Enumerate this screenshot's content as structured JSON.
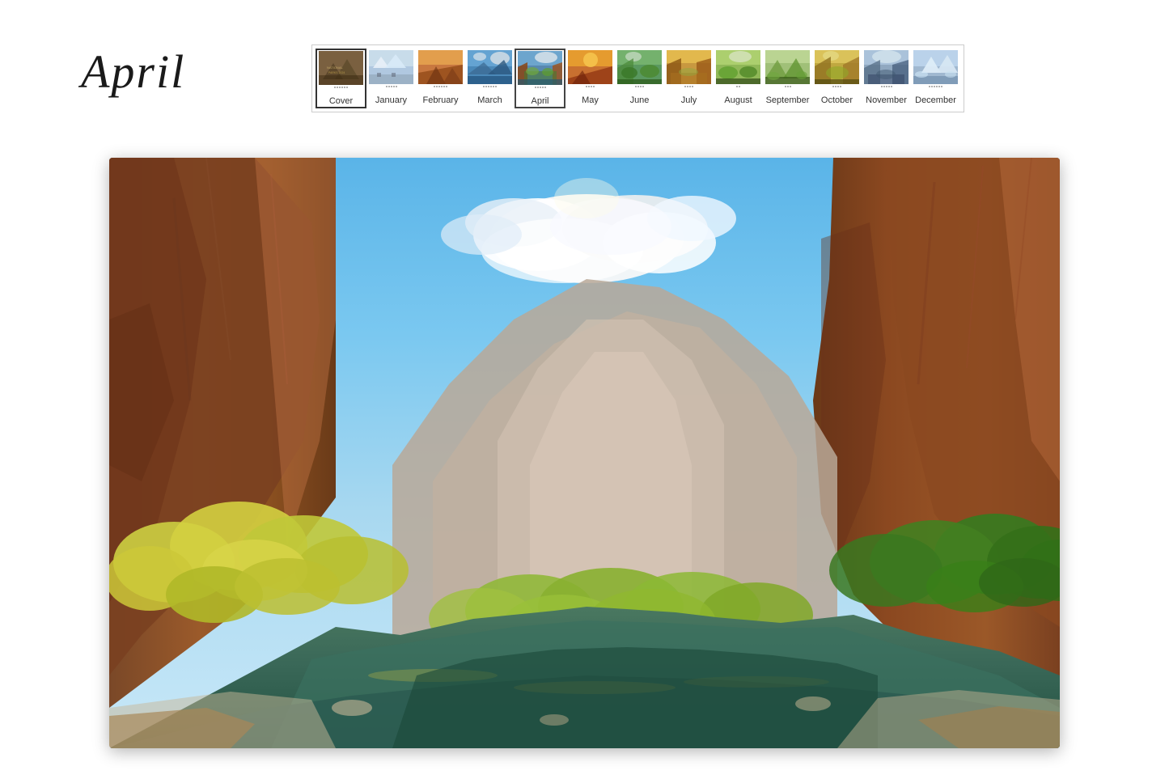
{
  "title": "April",
  "months": [
    {
      "id": "cover",
      "label": "Cover",
      "active": false,
      "colorClass": "thumb-cover"
    },
    {
      "id": "january",
      "label": "January",
      "active": false,
      "colorClass": "thumb-jan"
    },
    {
      "id": "february",
      "label": "February",
      "active": false,
      "colorClass": "thumb-feb"
    },
    {
      "id": "march",
      "label": "March",
      "active": false,
      "colorClass": "thumb-mar"
    },
    {
      "id": "april",
      "label": "April",
      "active": true,
      "colorClass": "thumb-apr"
    },
    {
      "id": "may",
      "label": "May",
      "active": false,
      "colorClass": "thumb-may"
    },
    {
      "id": "june",
      "label": "June",
      "active": false,
      "colorClass": "thumb-jun"
    },
    {
      "id": "july",
      "label": "July",
      "active": false,
      "colorClass": "thumb-jul"
    },
    {
      "id": "august",
      "label": "August",
      "active": false,
      "colorClass": "thumb-aug"
    },
    {
      "id": "september",
      "label": "September",
      "active": false,
      "colorClass": "thumb-sep"
    },
    {
      "id": "october",
      "label": "October",
      "active": false,
      "colorClass": "thumb-oct"
    },
    {
      "id": "november",
      "label": "November",
      "active": false,
      "colorClass": "thumb-nov"
    },
    {
      "id": "december",
      "label": "December",
      "active": false,
      "colorClass": "thumb-dec"
    }
  ]
}
